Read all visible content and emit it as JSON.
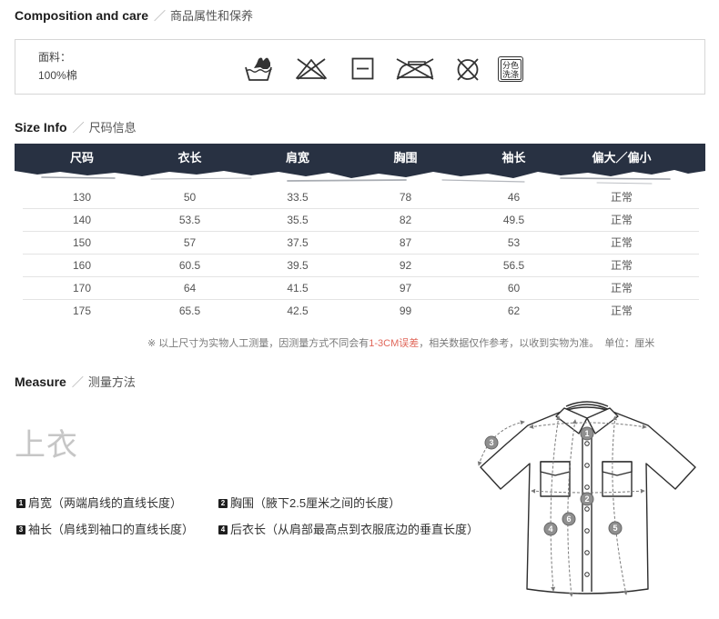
{
  "composition": {
    "title": "Composition and care",
    "separator": "／",
    "subtitle": "商品属性和保养",
    "fabric_label": "面料：",
    "fabric_value": "100%棉",
    "care_icons": [
      "hand-wash-icon",
      "do-not-bleach-icon",
      "dry-flat-icon",
      "do-not-iron-icon",
      "do-not-dry-clean-icon",
      "wash-separately-icon"
    ],
    "wash_separately_text": [
      "分色",
      "洗涤"
    ]
  },
  "size_info": {
    "title": "Size Info",
    "separator": "／",
    "subtitle": "尺码信息",
    "header_color": "#283142",
    "columns": [
      "尺码",
      "衣长",
      "肩宽",
      "胸围",
      "袖长",
      "偏大／偏小"
    ],
    "rows": [
      [
        "130",
        "50",
        "33.5",
        "78",
        "46",
        "正常"
      ],
      [
        "140",
        "53.5",
        "35.5",
        "82",
        "49.5",
        "正常"
      ],
      [
        "150",
        "57",
        "37.5",
        "87",
        "53",
        "正常"
      ],
      [
        "160",
        "60.5",
        "39.5",
        "92",
        "56.5",
        "正常"
      ],
      [
        "170",
        "64",
        "41.5",
        "97",
        "60",
        "正常"
      ],
      [
        "175",
        "65.5",
        "42.5",
        "99",
        "62",
        "正常"
      ]
    ],
    "note": {
      "prefix": "※ 以上尺寸为实物人工测量，因测量方式不同会有",
      "highlight": "1-3CM误差",
      "suffix": "，相关数据仅作参考，以收到实物为准。",
      "unit": "单位：厘米",
      "highlight_color": "#e0675a"
    }
  },
  "measure": {
    "title": "Measure",
    "separator": "／",
    "subtitle": "测量方法",
    "garment_type": "上衣",
    "items": [
      {
        "num": "1",
        "name": "肩宽",
        "desc": "（两端肩线的直线长度）"
      },
      {
        "num": "2",
        "name": "胸围",
        "desc": "（腋下2.5厘米之间的长度）"
      },
      {
        "num": "3",
        "name": "袖长",
        "desc": "（肩线到袖口的直线长度）"
      },
      {
        "num": "4",
        "name": "后衣长",
        "desc": "（从肩部最高点到衣服底边的垂直长度）"
      }
    ],
    "diagram_labels": [
      "1",
      "2",
      "3",
      "4",
      "5",
      "6"
    ]
  }
}
